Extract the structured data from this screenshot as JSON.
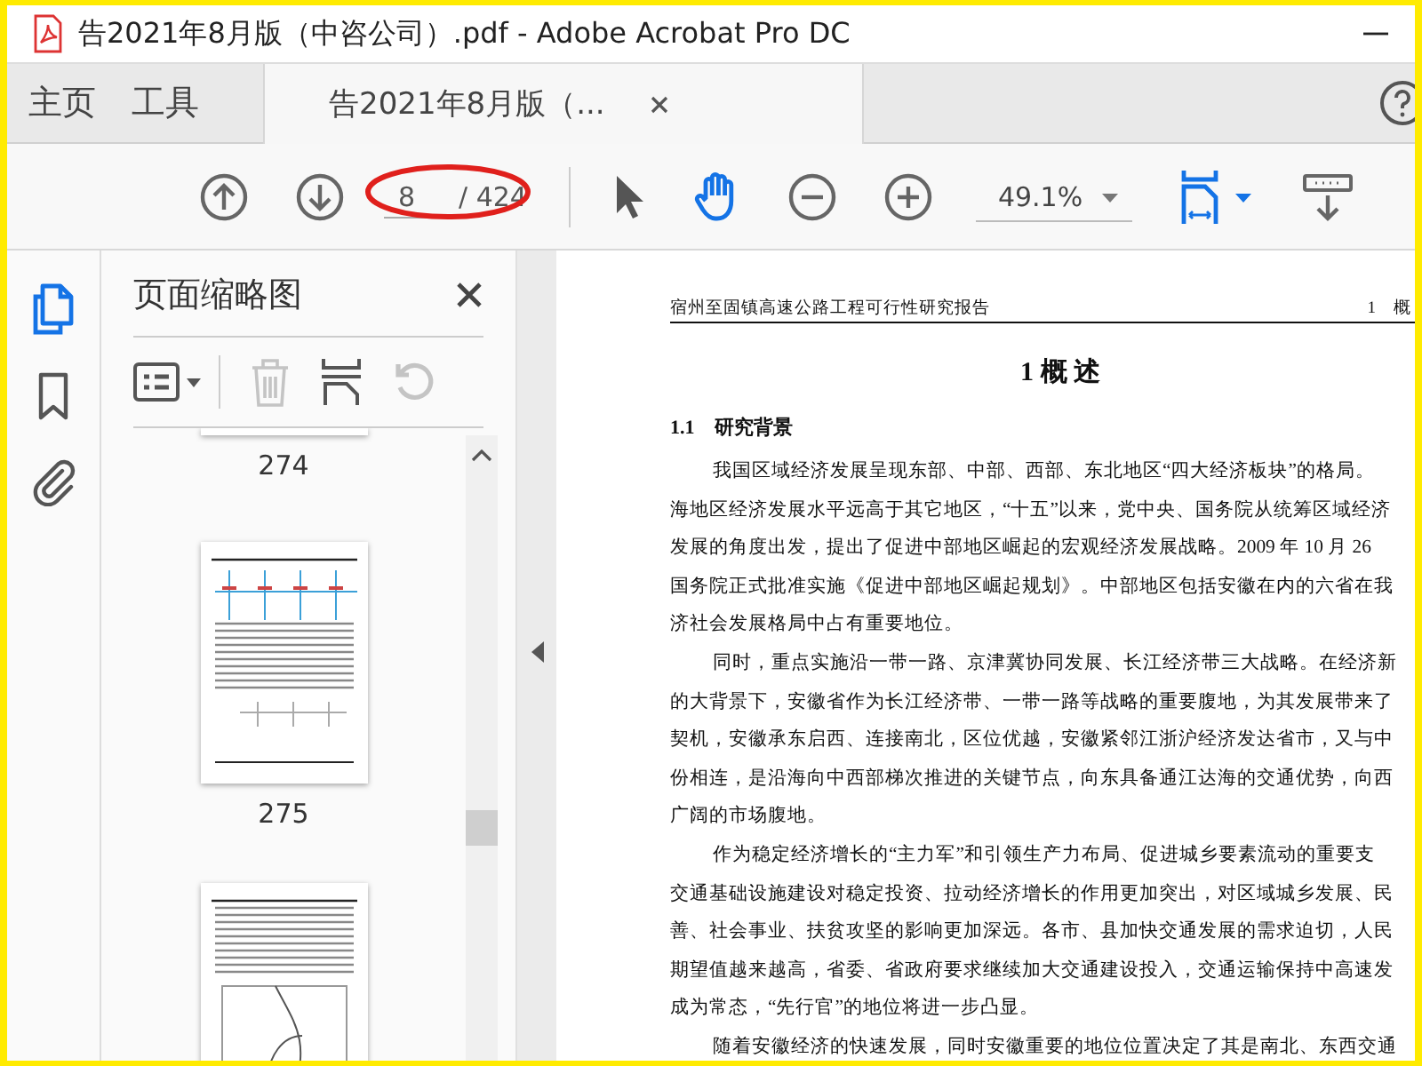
{
  "window": {
    "title": "告2021年8月版（中咨公司）.pdf - Adobe Acrobat Pro DC"
  },
  "tabs": [
    {
      "label": "主页",
      "kind": "nav",
      "selected": false
    },
    {
      "label": "工具",
      "kind": "nav",
      "selected": false
    },
    {
      "label": "告2021年8月版（...",
      "kind": "document",
      "selected": true
    }
  ],
  "toolbar": {
    "page_number": "8",
    "page_total": "/ 424",
    "zoom": "49.1%",
    "page_number_circled": true
  },
  "side_panel": {
    "title": "页面缩略图",
    "thumbnails": [
      {
        "label": "274",
        "kind": "cut"
      },
      {
        "label": "275",
        "kind": "figure"
      },
      {
        "kind": "map"
      }
    ]
  },
  "document": {
    "header_left": "宿州至固镇高速公路工程可行性研究报告",
    "header_right": "1　概",
    "chapter": "1  概 述",
    "section": "1.1　研究背景",
    "paragraphs": [
      {
        "lines": [
          "我国区域经济发展呈现东部、中部、西部、东北地区“四大经济板块”的格局。",
          "海地区经济发展水平远高于其它地区，“十五”以来，党中央、国务院从统筹区域经济",
          "发展的角度出发，提出了促进中部地区崛起的宏观经济发展战略。2009 年 10 月 26",
          "国务院正式批准实施《促进中部地区崛起规划》。中部地区包括安徽在内的六省在我",
          "济社会发展格局中占有重要地位。"
        ]
      },
      {
        "lines": [
          "同时，重点实施沿一带一路、京津冀协同发展、长江经济带三大战略。在经济新",
          "的大背景下，安徽省作为长江经济带、一带一路等战略的重要腹地，为其发展带来了",
          "契机，安徽承东启西、连接南北，区位优越，安徽紧邻江浙沪经济发达省市，又与中",
          "份相连，是沿海向中西部梯次推进的关键节点，向东具备通江达海的交通优势，向西",
          "广阔的市场腹地。"
        ]
      },
      {
        "lines": [
          "作为稳定经济增长的“主力军”和引领生产力布局、促进城乡要素流动的重要支",
          "交通基础设施建设对稳定投资、拉动经济增长的作用更加突出，对区域城乡发展、民",
          "善、社会事业、扶贫攻坚的影响更加深远。各市、县加快交通发展的需求迫切，人民",
          "期望值越来越高，省委、省政府要求继续加大交通建设投入，交通运输保持中高速发",
          "成为常态，“先行官”的地位将进一步凸显。"
        ]
      },
      {
        "lines": [
          "随着安徽经济的快速发展，同时安徽重要的地位位置决定了其是南北、东西交通"
        ]
      }
    ]
  }
}
